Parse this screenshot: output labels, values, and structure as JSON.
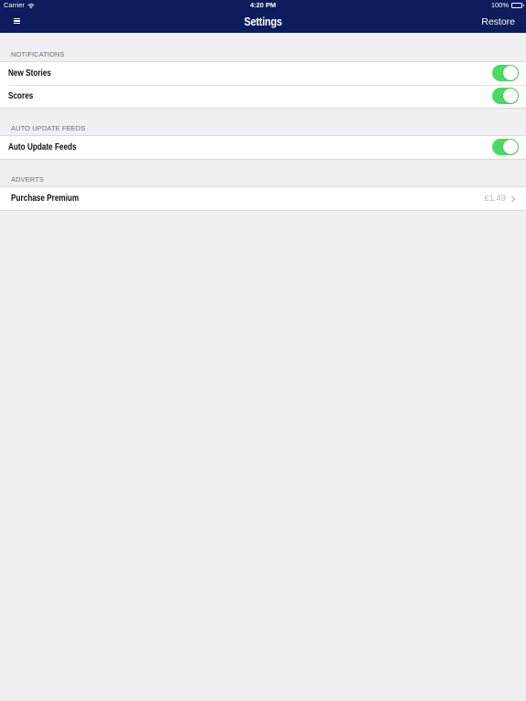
{
  "status_bar": {
    "carrier": "Carrier",
    "wifi_icon": "wifi-icon",
    "time": "4:20 PM",
    "battery_percent": "100%",
    "battery_icon": "battery-icon"
  },
  "nav": {
    "menu_icon": "hamburger-menu-icon",
    "title": "Settings",
    "restore_label": "Restore"
  },
  "sections": {
    "notifications": {
      "header": "NOTIFICATIONS",
      "rows": [
        {
          "label": "New Stories",
          "toggle_on": true
        },
        {
          "label": "Scores",
          "toggle_on": true
        }
      ]
    },
    "auto_update": {
      "header": "AUTO UPDATE FEEDS",
      "rows": [
        {
          "label": "Auto Update Feeds",
          "toggle_on": true
        }
      ]
    },
    "adverts": {
      "header": "ADVERTS",
      "rows": [
        {
          "label": "Purchase Premium",
          "price": "£1.49",
          "chevron_icon": "chevron-right-icon"
        }
      ]
    }
  },
  "colors": {
    "nav_background": "#0d1c5c",
    "page_background": "#efeff4",
    "toggle_on": "#4cd964",
    "section_header_text": "#6d6d72",
    "price_text": "#b5b5ba"
  }
}
